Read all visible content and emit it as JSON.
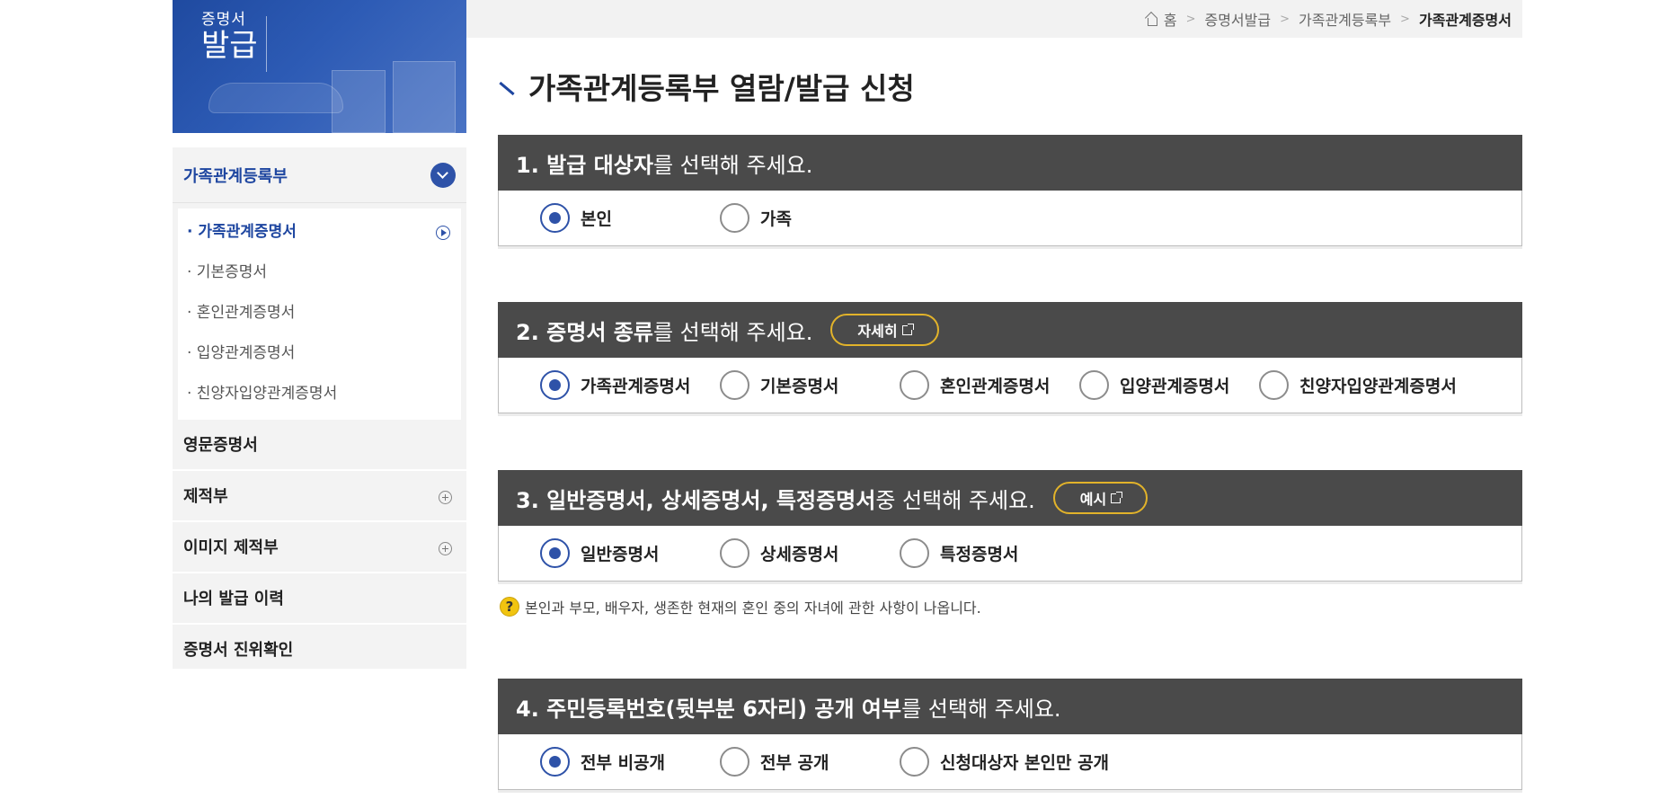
{
  "banner": {
    "logo_small": "증명서",
    "logo_big": "발급"
  },
  "sidebar": {
    "header": "가족관계등록부",
    "sub_items": [
      {
        "label": "· 가족관계증명서",
        "active": true
      },
      {
        "label": "· 기본증명서"
      },
      {
        "label": "· 혼인관계증명서"
      },
      {
        "label": "· 입양관계증명서"
      },
      {
        "label": "· 친양자입양관계증명서"
      }
    ],
    "menu_items": [
      {
        "label": "영문증명서"
      },
      {
        "label": "제적부"
      },
      {
        "label": "이미지 제적부"
      },
      {
        "label": "나의 발급 이력"
      },
      {
        "label": "증명서 진위확인"
      }
    ]
  },
  "breadcrumb": {
    "home": "홈",
    "items": [
      "증명서발급",
      "가족관계등록부"
    ],
    "current": "가족관계증명서"
  },
  "page_title": "가족관계등록부 열람/발급 신청",
  "sections": [
    {
      "head_bold": "1. 발급 대상자",
      "head_rest": "를 선택해 주세요.",
      "options": [
        "본인",
        "가족"
      ],
      "selected": 0
    },
    {
      "head_bold": "2. 증명서 종류",
      "head_rest": "를 선택해 주세요.",
      "button": "자세히",
      "options": [
        "가족관계증명서",
        "기본증명서",
        "혼인관계증명서",
        "입양관계증명서",
        "친양자입양관계증명서"
      ],
      "selected": 0
    },
    {
      "head_bold": "3. 일반증명서, 상세증명서, 특정증명서",
      "head_rest": " 중 선택해 주세요.",
      "button": "예시",
      "options": [
        "일반증명서",
        "상세증명서",
        "특정증명서"
      ],
      "selected": 0
    },
    {
      "head_bold": "4. 주민등록번호(뒷부분 6자리) 공개 여부",
      "head_rest": "를 선택해 주세요.",
      "options": [
        "전부 비공개",
        "전부 공개",
        "신청대상자 본인만 공개"
      ],
      "selected": 0
    }
  ],
  "note": "본인과 부모, 배우자, 생존한 현재의 혼인 중의 자녀에 관한 사항이 나옵니다.",
  "colors": {
    "accent": "#2e52a8",
    "header_bg": "#4a4a4a",
    "pill_border": "#e2b32a"
  }
}
